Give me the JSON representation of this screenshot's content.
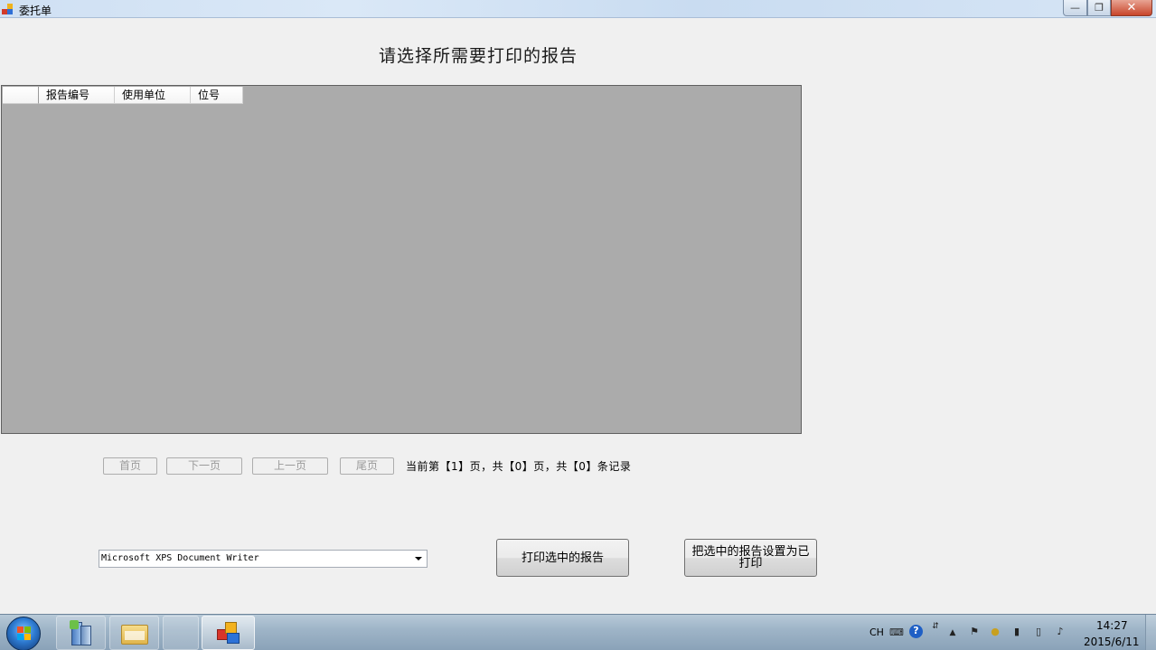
{
  "window": {
    "title": "委托单",
    "minimize_label": "—",
    "maximize_label": "❐",
    "close_label": "✕"
  },
  "heading": "请选择所需要打印的报告",
  "grid": {
    "columns": [
      "报告编号",
      "使用单位",
      "位号"
    ],
    "rows": []
  },
  "paging": {
    "first_label": "首页",
    "next_label": "下一页",
    "prev_label": "上一页",
    "last_label": "尾页",
    "info": "当前第【1】页，共【0】页，共【0】条记录"
  },
  "printer": {
    "selected": "Microsoft XPS Document Writer"
  },
  "actions": {
    "print_selected_label": "打印选中的报告",
    "mark_printed_label": "把选中的报告设置为已打印"
  },
  "taskbar": {
    "tray": {
      "language": "CH"
    },
    "clock": {
      "time": "14:27",
      "date": "2015/6/11"
    }
  },
  "colors": {
    "grid_background": "#ababab",
    "window_background": "#f0f0f0",
    "disabled_text": "#9a9a9a"
  }
}
